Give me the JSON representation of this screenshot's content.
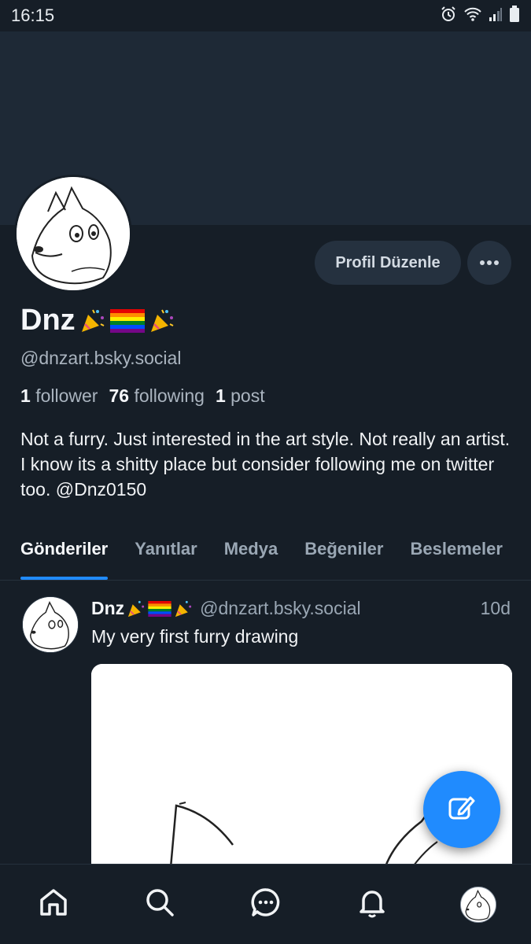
{
  "status_bar": {
    "time": "16:15",
    "icons": [
      "alarm-icon",
      "wifi-icon",
      "signal-icon",
      "battery-icon"
    ]
  },
  "profile": {
    "display_name": "Dnz",
    "name_emojis": [
      "party-popper-icon",
      "rainbow-flag-icon",
      "party-popper-icon"
    ],
    "handle": "@dnzart.bsky.social",
    "edit_button_label": "Profil Düzenle",
    "stats": {
      "followers_count": "1",
      "followers_label": "follower",
      "following_count": "76",
      "following_label": "following",
      "posts_count": "1",
      "posts_label": "post"
    },
    "bio": "Not a furry. Just interested in the art style. Not really an artist. I know its a shitty place but consider following me on twitter too. @Dnz0150"
  },
  "tabs": [
    {
      "label": "Gönderiler",
      "active": true
    },
    {
      "label": "Yanıtlar",
      "active": false
    },
    {
      "label": "Medya",
      "active": false
    },
    {
      "label": "Beğeniler",
      "active": false
    },
    {
      "label": "Beslemeler",
      "active": false
    }
  ],
  "post": {
    "author_name": "Dnz",
    "author_handle": "@dnzart.bsky.social",
    "time": "10d",
    "text": "My very first furry drawing"
  },
  "nav": [
    "home-icon",
    "search-icon",
    "chat-icon",
    "bell-icon",
    "profile-avatar"
  ],
  "colors": {
    "background": "#161e27",
    "banner": "#1e2936",
    "accent": "#208bfe",
    "muted_text": "#9aa7b4"
  }
}
